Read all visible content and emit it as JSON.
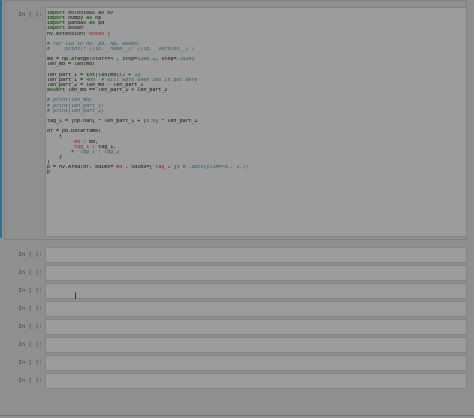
{
  "colors": {
    "page_background": "#8f8f8f",
    "cell_input_background": "#9c9c9c",
    "selected_cell_indicator": "#2f6f8f"
  },
  "cells": [
    {
      "prompt": "In [ ]:",
      "selected": true,
      "code_lines": [
        "import holoviews as hv",
        "import numpy as np",
        "import pandas as pd",
        "import bokeh",
        "hv.extension('bokeh')",
        "",
        "# for lib in hv, pd, np, bokeh:",
        "#     print(f'{lib.__name__}: {lib.__version__}')",
        "",
        "md = np.arange(start=4 , stop=1100.1, step=.1524)",
        "len_md = len(md)",
        "",
        "len_part_1 = int(len(md)/2 + 1)",
        "len_part_1 = 400  # will work when 500 is put here",
        "len_part_2 = len_md - len_part_1",
        "assert len_md == len_part_1 + len_part_2",
        "",
        "# print(len_md)",
        "# print(len_part_1)",
        "# print(len_part_2)",
        "",
        "tag_1 = [np.nan] * len_part_1 + [0.0] * len_part_2",
        "",
        "df = pd.DataFrame(",
        "    {",
        "        'md': md,",
        "        'tag_1': tag_1,",
        "        # 'log_1': log_2",
        "    }",
        ")",
        "p = hv.Area(df, kdims='md', vdims=['tag_1']) # .opts(ylim=(0., 1.))",
        "p"
      ]
    },
    {
      "prompt": "In [ ]:",
      "selected": false,
      "code_lines": []
    },
    {
      "prompt": "In [ ]:",
      "selected": false,
      "code_lines": []
    },
    {
      "prompt": "In [ ]:",
      "selected": false,
      "code_lines": []
    },
    {
      "prompt": "In [ ]:",
      "selected": false,
      "code_lines": []
    },
    {
      "prompt": "In [ ]:",
      "selected": false,
      "code_lines": []
    },
    {
      "prompt": "In [ ]:",
      "selected": false,
      "code_lines": []
    },
    {
      "prompt": "In [ ]:",
      "selected": false,
      "code_lines": []
    },
    {
      "prompt": "In [ ]:",
      "selected": false,
      "code_lines": []
    }
  ],
  "cursor_icon": "text-cursor-icon"
}
